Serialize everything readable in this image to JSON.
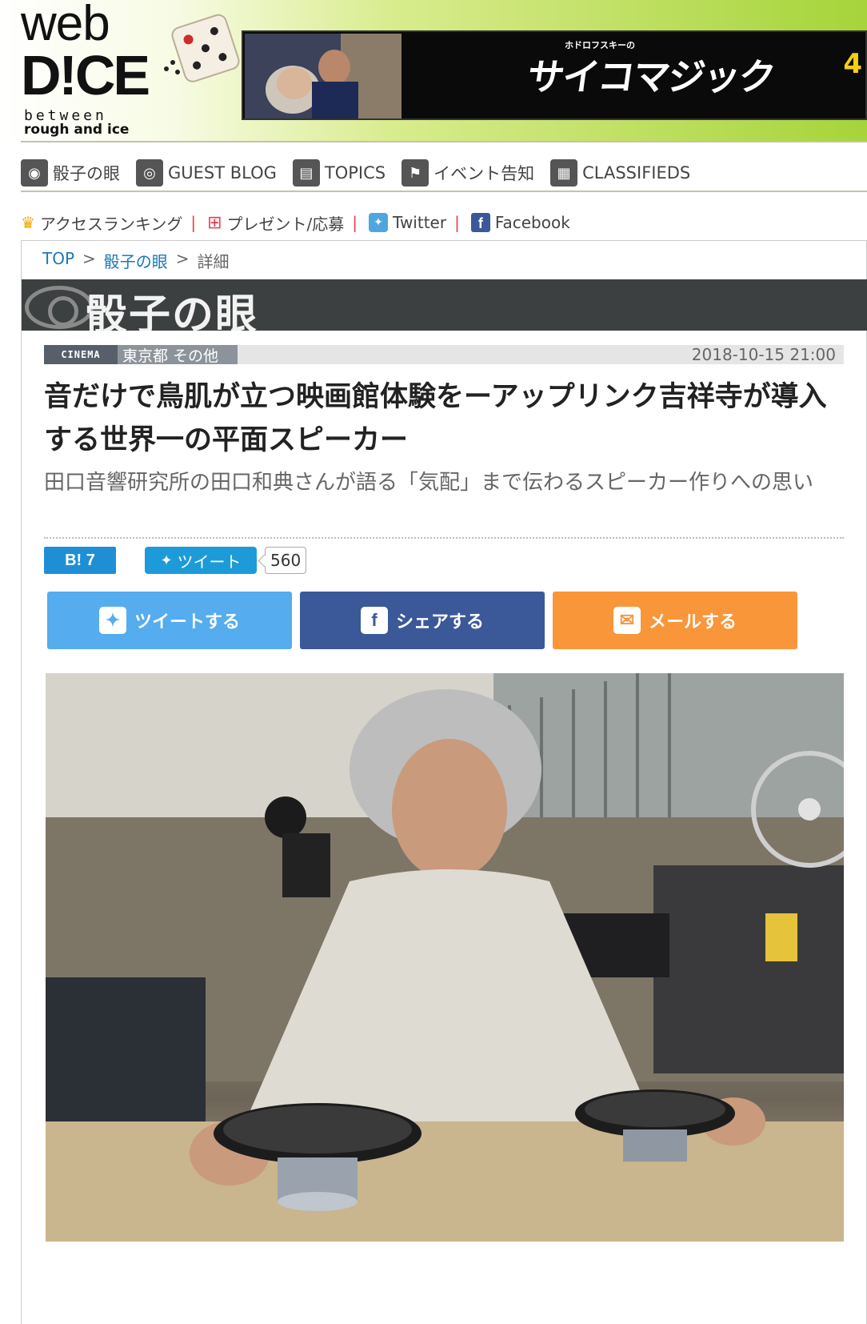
{
  "header": {
    "logo": {
      "web": "web",
      "dice": "D!CE",
      "between": "between",
      "rough": "rough and ice"
    },
    "banner": {
      "sub": "ホドロフスキーの",
      "title": "サイコマジック",
      "edge": "4"
    }
  },
  "nav": {
    "items": [
      {
        "label": "骰子の眼",
        "icon": "eye-icon"
      },
      {
        "label": "GUEST BLOG",
        "icon": "guest-icon"
      },
      {
        "label": "TOPICS",
        "icon": "briefcase-icon"
      },
      {
        "label": "イベント告知",
        "icon": "flag-icon"
      },
      {
        "label": "CLASSIFIEDS",
        "icon": "board-icon"
      }
    ]
  },
  "subnav": {
    "ranking": "アクセスランキング",
    "present": "プレゼント/応募",
    "twitter": "Twitter",
    "facebook": "Facebook",
    "sep": "|"
  },
  "breadcrumb": {
    "top": "TOP",
    "section": "骰子の眼",
    "current": "詳細",
    "sep": ">"
  },
  "section": {
    "title": "骰子の眼"
  },
  "article": {
    "category": "CINEMA",
    "location": "東京都 その他",
    "date": "2018-10-15 21:00",
    "title": "音だけで鳥肌が立つ映画館体験をーアップリンク吉祥寺が導入する世界一の平面スピーカー",
    "subtitle": "田口音響研究所の田口和典さんが語る「気配」まで伝わるスピーカー作りへの思い"
  },
  "share": {
    "hatena_label": "B! 7",
    "tweet_label": "ツイート",
    "tweet_count": "560",
    "tweet_button": "ツイートする",
    "share_button": "シェアする",
    "mail_button": "メールする"
  },
  "colors": {
    "twitter": "#55acee",
    "facebook": "#3b5998",
    "mail": "#f9963a",
    "link": "#1a7ab8",
    "section_bar": "#3d4040"
  }
}
